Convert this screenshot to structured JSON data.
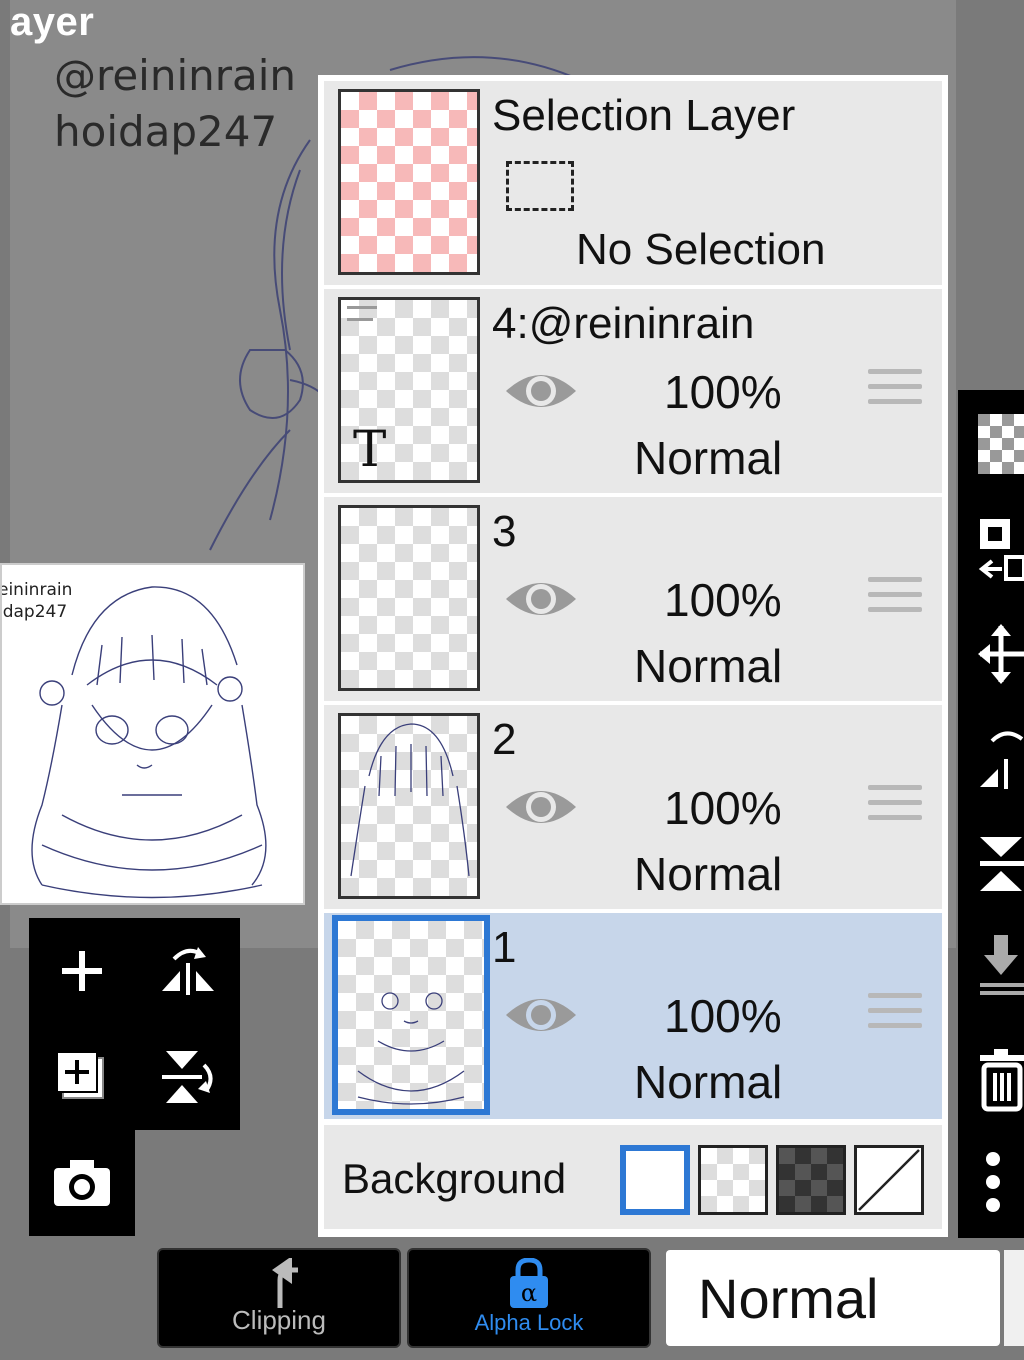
{
  "screen_title": "ayer",
  "watermark": {
    "line1": "@reininrain",
    "line2": "hoidap247"
  },
  "preview": {
    "line1": "eininrain",
    "line2": "idap247"
  },
  "selection_layer": {
    "title": "Selection Layer",
    "status": "No Selection"
  },
  "layers": [
    {
      "name": "4:@reininrain",
      "opacity": "100%",
      "blend": "Normal",
      "type_badge": "T",
      "selected": false
    },
    {
      "name": "3",
      "opacity": "100%",
      "blend": "Normal",
      "selected": false
    },
    {
      "name": "2",
      "opacity": "100%",
      "blend": "Normal",
      "selected": false
    },
    {
      "name": "1",
      "opacity": "100%",
      "blend": "Normal",
      "selected": true
    }
  ],
  "background": {
    "label": "Background",
    "options": [
      "white",
      "transparent",
      "dark-checker",
      "none"
    ],
    "selected": "white"
  },
  "left_tools": [
    "add-layer-icon",
    "flip-horizontal-icon",
    "duplicate-layer-icon",
    "flip-vertical-icon",
    "camera-icon"
  ],
  "right_tools": [
    "checker-icon",
    "select-transform-icon",
    "move-icon",
    "flip-icon",
    "merge-down-icon",
    "download-icon",
    "trash-icon",
    "more-icon"
  ],
  "bottom_bar": {
    "clipping_label": "Clipping",
    "alpha_lock_label": "Alpha Lock",
    "blend_mode": "Normal"
  },
  "colors": {
    "accent": "#2d78d4",
    "selected_row": "#c7d6ea",
    "row": "#e8e8e8",
    "alpha_lock": "#2f8cf0"
  }
}
